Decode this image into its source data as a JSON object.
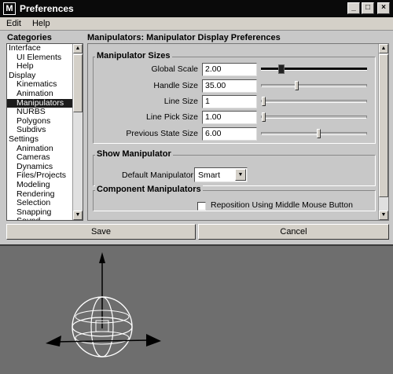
{
  "window": {
    "title": "Preferences",
    "icon_letter": "M",
    "buttons": [
      "_",
      "□",
      "×"
    ]
  },
  "menu": [
    "Edit",
    "Help"
  ],
  "categories": {
    "title": "Categories",
    "items": [
      {
        "label": "Interface",
        "level": 0
      },
      {
        "label": "UI Elements",
        "level": 1
      },
      {
        "label": "Help",
        "level": 1
      },
      {
        "label": "Display",
        "level": 0
      },
      {
        "label": "Kinematics",
        "level": 1
      },
      {
        "label": "Animation",
        "level": 1
      },
      {
        "label": "Manipulators",
        "level": 1,
        "selected": true
      },
      {
        "label": "NURBS",
        "level": 1
      },
      {
        "label": "Polygons",
        "level": 1
      },
      {
        "label": "Subdivs",
        "level": 1
      },
      {
        "label": "Settings",
        "level": 0
      },
      {
        "label": "Animation",
        "level": 1
      },
      {
        "label": "Cameras",
        "level": 1
      },
      {
        "label": "Dynamics",
        "level": 1
      },
      {
        "label": "Files/Projects",
        "level": 1
      },
      {
        "label": "Modeling",
        "level": 1
      },
      {
        "label": "Rendering",
        "level": 1
      },
      {
        "label": "Selection",
        "level": 1
      },
      {
        "label": "Snapping",
        "level": 1
      },
      {
        "label": "Sound",
        "level": 1
      }
    ]
  },
  "panel": {
    "title": "Manipulators: Manipulator Display Preferences",
    "manipulator_sizes": {
      "title": "Manipulator Sizes",
      "rows": [
        {
          "label": "Global Scale",
          "value": "2.00",
          "slider": 0.17,
          "style": "dark"
        },
        {
          "label": "Handle Size",
          "value": "35.00",
          "slider": 0.33,
          "style": "light"
        },
        {
          "label": "Line Size",
          "value": "1",
          "slider": 0.0,
          "style": "light"
        },
        {
          "label": "Line Pick Size",
          "value": "1.00",
          "slider": 0.0,
          "style": "light"
        },
        {
          "label": "Previous State Size",
          "value": "6.00",
          "slider": 0.55,
          "style": "light"
        }
      ]
    },
    "show_manipulator": {
      "title": "Show Manipulator",
      "default_label": "Default Manipulator",
      "default_value": "Smart"
    },
    "component_manipulators": {
      "title": "Component Manipulators",
      "checkbox_label": "Reposition Using Middle Mouse Button",
      "checked": false
    }
  },
  "buttons": {
    "save": "Save",
    "cancel": "Cancel"
  },
  "colors": {
    "titlebar": "#0a0a0a",
    "dialog_bg": "#c8c8c8",
    "viewport_bg": "#6e6e6e",
    "selection": "#1c1c1c"
  },
  "icons": {
    "arrow_up": "▲",
    "arrow_down": "▼"
  }
}
